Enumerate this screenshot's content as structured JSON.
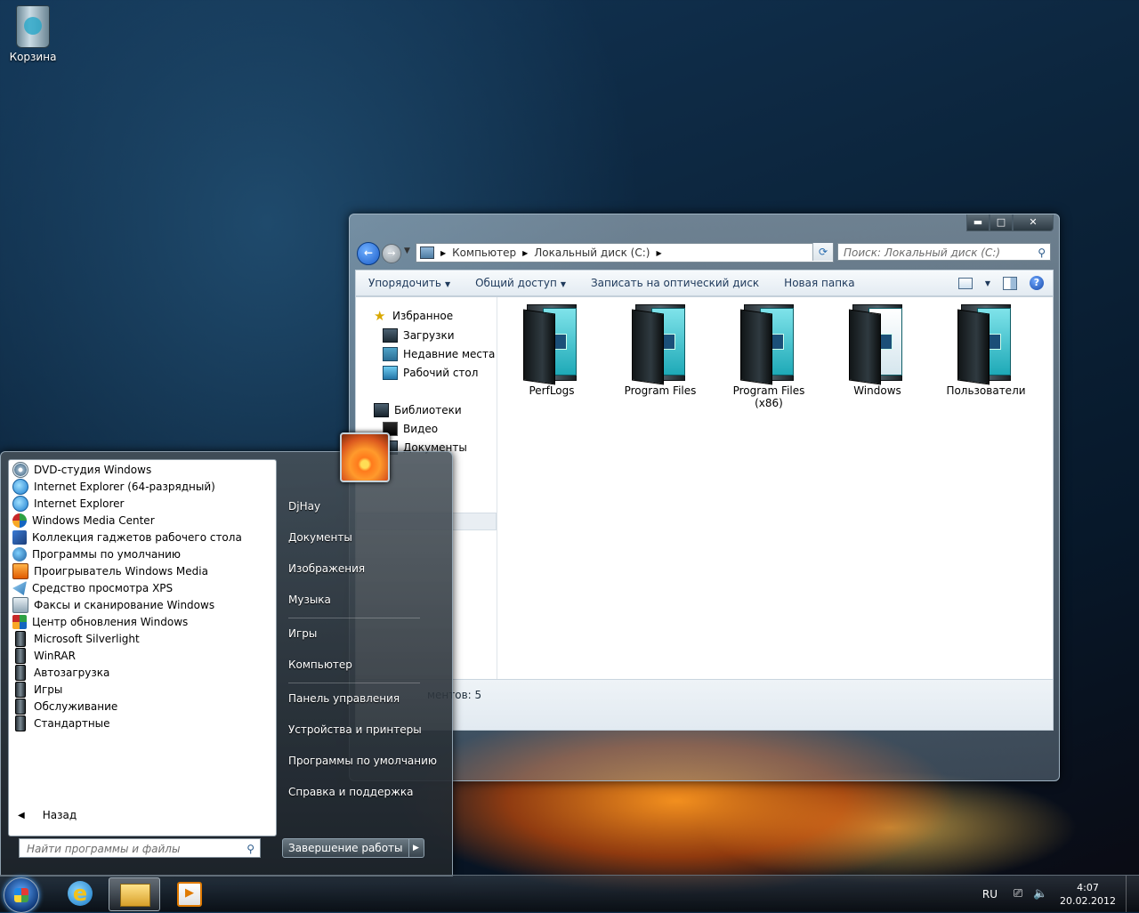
{
  "desktop": {
    "recycle_bin": "Корзина"
  },
  "explorer": {
    "breadcrumb": [
      "Компьютер",
      "Локальный диск (C:)"
    ],
    "search_placeholder": "Поиск: Локальный диск (C:)",
    "toolbar": {
      "organize": "Упорядочить",
      "share": "Общий доступ",
      "burn": "Записать на оптический диск",
      "new_folder": "Новая папка"
    },
    "nav": {
      "favorites": "Избранное",
      "downloads": "Загрузки",
      "recent": "Недавние места",
      "desktop": "Рабочий стол",
      "libraries": "Библиотеки",
      "video": "Видео",
      "documents": "Документы"
    },
    "files": [
      {
        "name": "PerfLogs",
        "sub": ""
      },
      {
        "name": "Program Files",
        "sub": ""
      },
      {
        "name": "Program Files",
        "sub": "(x86)"
      },
      {
        "name": "Windows",
        "sub": ""
      },
      {
        "name": "Пользователи",
        "sub": ""
      }
    ],
    "status": "ментов: 5"
  },
  "start_menu": {
    "programs": [
      {
        "label": "DVD-студия Windows",
        "icon": "dvd-maker-icon"
      },
      {
        "label": "Internet Explorer (64-разрядный)",
        "icon": "internet-explorer-icon"
      },
      {
        "label": "Internet Explorer",
        "icon": "internet-explorer-icon"
      },
      {
        "label": "Windows Media Center",
        "icon": "media-center-icon"
      },
      {
        "label": "Коллекция гаджетов рабочего стола",
        "icon": "gadgets-icon"
      },
      {
        "label": "Программы по умолчанию",
        "icon": "default-programs-icon"
      },
      {
        "label": "Проигрыватель Windows Media",
        "icon": "media-player-icon"
      },
      {
        "label": "Средство просмотра XPS",
        "icon": "xps-viewer-icon"
      },
      {
        "label": "Факсы и сканирование Windows",
        "icon": "fax-scan-icon"
      },
      {
        "label": "Центр обновления Windows",
        "icon": "windows-update-icon"
      },
      {
        "label": "Microsoft Silverlight",
        "icon": "folder-icon"
      },
      {
        "label": "WinRAR",
        "icon": "folder-icon"
      },
      {
        "label": "Автозагрузка",
        "icon": "folder-icon"
      },
      {
        "label": "Игры",
        "icon": "folder-icon"
      },
      {
        "label": "Обслуживание",
        "icon": "folder-icon"
      },
      {
        "label": "Стандартные",
        "icon": "folder-icon"
      }
    ],
    "back": "Назад",
    "search_placeholder": "Найти программы и файлы",
    "right": {
      "user": "DjHay",
      "documents": "Документы",
      "pictures": "Изображения",
      "music": "Музыка",
      "games": "Игры",
      "computer": "Компьютер",
      "control_panel": "Панель управления",
      "devices": "Устройства и принтеры",
      "default_programs": "Программы по умолчанию",
      "help": "Справка и поддержка"
    },
    "shutdown": "Завершение работы"
  },
  "taskbar": {
    "lang": "RU",
    "time": "4:07",
    "date": "20.02.2012"
  }
}
